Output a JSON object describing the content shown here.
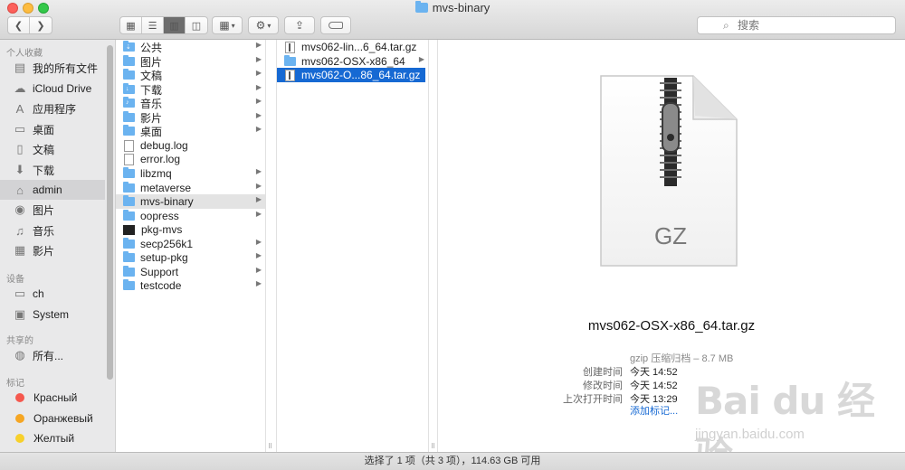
{
  "window": {
    "title": "mvs-binary"
  },
  "toolbar": {
    "back_icon": "chevron-left-icon",
    "forward_icon": "chevron-right-icon",
    "search_placeholder": "搜索"
  },
  "sidebar": {
    "favorites_header": "个人收藏",
    "favorites": [
      {
        "label": "我的所有文件",
        "icon": "all-files-icon"
      },
      {
        "label": "iCloud Drive",
        "icon": "cloud-icon"
      },
      {
        "label": "应用程序",
        "icon": "applications-icon"
      },
      {
        "label": "桌面",
        "icon": "desktop-icon"
      },
      {
        "label": "文稿",
        "icon": "documents-icon"
      },
      {
        "label": "下载",
        "icon": "download-icon"
      },
      {
        "label": "admin",
        "icon": "home-icon",
        "selected": true
      },
      {
        "label": "图片",
        "icon": "camera-icon"
      },
      {
        "label": "音乐",
        "icon": "music-icon"
      },
      {
        "label": "影片",
        "icon": "film-icon"
      }
    ],
    "devices_header": "设备",
    "devices": [
      {
        "label": "ch",
        "icon": "computer-icon"
      },
      {
        "label": "System",
        "icon": "disk-icon"
      }
    ],
    "shared_header": "共享的",
    "shared": [
      {
        "label": "所有...",
        "icon": "network-icon"
      }
    ],
    "tags_header": "标记",
    "tags": [
      {
        "label": "Красный",
        "color": "#f5584e"
      },
      {
        "label": "Оранжевый",
        "color": "#f5a623"
      },
      {
        "label": "Желтый",
        "color": "#f7d02c"
      }
    ]
  },
  "column1": [
    {
      "label": "公共",
      "kind": "folder",
      "badge": "⇣"
    },
    {
      "label": "图片",
      "kind": "folder",
      "badge": ""
    },
    {
      "label": "文稿",
      "kind": "folder",
      "badge": ""
    },
    {
      "label": "下载",
      "kind": "folder",
      "badge": "↓"
    },
    {
      "label": "音乐",
      "kind": "folder",
      "badge": "♪"
    },
    {
      "label": "影片",
      "kind": "folder",
      "badge": ""
    },
    {
      "label": "桌面",
      "kind": "folder",
      "badge": ""
    },
    {
      "label": "debug.log",
      "kind": "file"
    },
    {
      "label": "error.log",
      "kind": "file"
    },
    {
      "label": "libzmq",
      "kind": "folder"
    },
    {
      "label": "metaverse",
      "kind": "folder"
    },
    {
      "label": "mvs-binary",
      "kind": "folder",
      "highlighted": true
    },
    {
      "label": "oopress",
      "kind": "folder"
    },
    {
      "label": "pkg-mvs",
      "kind": "exec"
    },
    {
      "label": "secp256k1",
      "kind": "folder"
    },
    {
      "label": "setup-pkg",
      "kind": "folder"
    },
    {
      "label": "Support",
      "kind": "folder"
    },
    {
      "label": "testcode",
      "kind": "folder"
    }
  ],
  "column2": [
    {
      "label": "mvs062-lin...6_64.tar.gz",
      "kind": "gz"
    },
    {
      "label": "mvs062-OSX-x86_64",
      "kind": "folder"
    },
    {
      "label": "mvs062-O...86_64.tar.gz",
      "kind": "gz",
      "selected": true
    }
  ],
  "preview": {
    "icon_label": "GZ",
    "file_name": "mvs062-OSX-x86_64.tar.gz",
    "type_size": "gzip 压缩归档 – 8.7 MB",
    "created_label": "创建时间",
    "created_value": "今天 14:52",
    "modified_label": "修改时间",
    "modified_value": "今天 14:52",
    "opened_label": "上次打开时间",
    "opened_value": "今天 13:29",
    "add_tags": "添加标记..."
  },
  "watermark": {
    "brand": "Bai du 经验",
    "url": "jingyan.baidu.com"
  },
  "status_bar": "选择了 1 项（共 3 项），114.63 GB 可用"
}
